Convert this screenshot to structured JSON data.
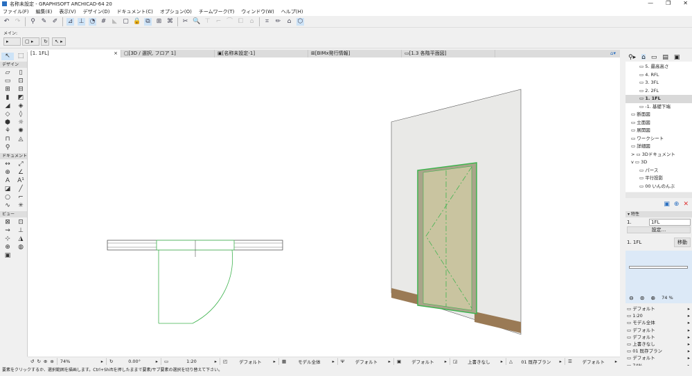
{
  "window": {
    "title": "名称未設定 - GRAPHISOFT ARCHICAD-64 20",
    "minimize": "—",
    "restore": "❐",
    "close": "✕"
  },
  "menu": [
    "ファイル(F)",
    "編集(E)",
    "表示(V)",
    "デザイン(D)",
    "ドキュメント(C)",
    "オプション(O)",
    "チームワーク(T)",
    "ウィンドウ(W)",
    "ヘルプ(H)"
  ],
  "infobox": {
    "label": "メイン:"
  },
  "tabs": [
    {
      "label": "[1. 1FL]",
      "close": "×"
    },
    {
      "label": "[3D / 選択, フロア 1]"
    },
    {
      "label": "[名称未設定-1]"
    },
    {
      "label": "[BIMx発行情報]"
    },
    {
      "label": "[1.3 各階平面図]"
    }
  ],
  "toolbox": {
    "sections": [
      "デザイン",
      "ドキュメント",
      "ビュー"
    ]
  },
  "navigator": {
    "items": [
      {
        "label": "5. 最高高さ",
        "indent": 2
      },
      {
        "label": "4. RFL",
        "indent": 2
      },
      {
        "label": "3. 3FL",
        "indent": 2
      },
      {
        "label": "2. 2FL",
        "indent": 2
      },
      {
        "label": "1. 1FL",
        "indent": 2,
        "selected": true
      },
      {
        "label": "-1. 基礎下端",
        "indent": 2
      },
      {
        "label": "断面図",
        "indent": 1
      },
      {
        "label": "立面図",
        "indent": 1
      },
      {
        "label": "展開図",
        "indent": 1
      },
      {
        "label": "ワークシート",
        "indent": 1
      },
      {
        "label": "詳細図",
        "indent": 1
      },
      {
        "label": "3Dドキュメント",
        "indent": 1,
        "arrow": ">"
      },
      {
        "label": "3D",
        "indent": 1,
        "arrow": "v"
      },
      {
        "label": "パース",
        "indent": 2
      },
      {
        "label": "平行投影",
        "indent": 2
      },
      {
        "label": "00 いんのんぶ",
        "indent": 2
      }
    ]
  },
  "properties": {
    "header": "特性",
    "id": "1.",
    "name": "1FL",
    "settings": "設定...",
    "current": "1. 1FL",
    "move": "移動"
  },
  "zoom": {
    "value": "74 %"
  },
  "view_props": [
    "デフォルト",
    "1:20",
    "モデル全体",
    "デフォルト",
    "デフォルト",
    "上書きなし",
    "01 既存プラン",
    "デフォルト",
    "74%",
    "0.00°"
  ],
  "status": {
    "zoom": "74%",
    "angle": "0.00°",
    "scale": "1:20",
    "layers": "デフォルト",
    "model": "モデル全体",
    "pen": "デフォルト",
    "mvo": "デフォルト",
    "override": "上書きなし",
    "renovation": "01 既存プラン",
    "dim": "デフォルト"
  },
  "message": "要素をクリックするか、選択範囲を描画します。Ctrl+Shiftを押したままで要素/サブ要素の選択を切り替えて下さい。",
  "colors": {
    "accent": "#cde3f7",
    "selection_green": "#3fb34f",
    "wall": "#e8e8e6",
    "door": "#c9c4a0"
  }
}
